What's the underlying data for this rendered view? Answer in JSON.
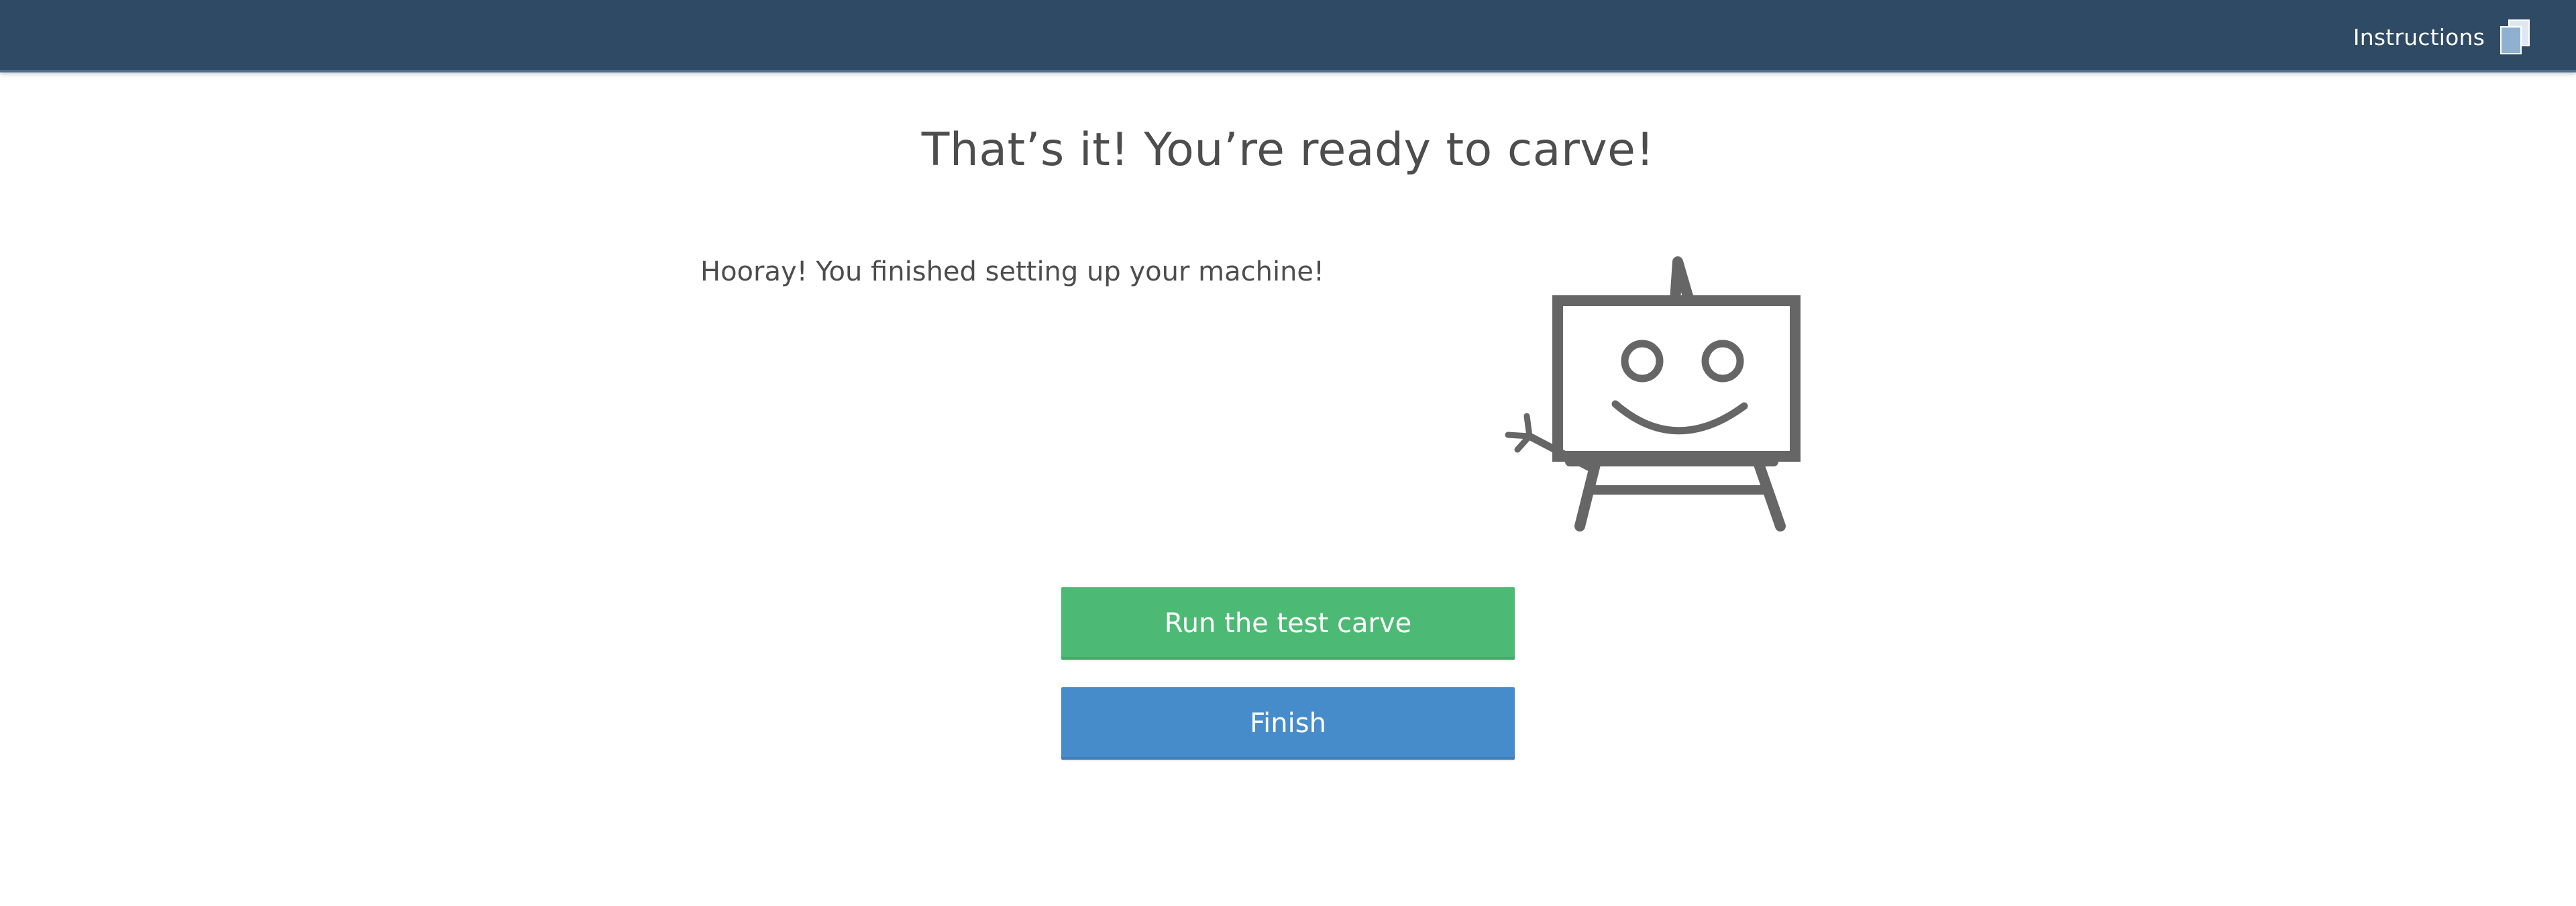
{
  "header": {
    "instructions_label": "Instructions",
    "instructions_icon": "documents-icon",
    "background_color": "#2e4a65"
  },
  "main": {
    "title": "That’s it! You’re ready to carve!",
    "message": "Hooray! You finished setting up your machine!",
    "illustration": "waving-easel-robot-icon"
  },
  "actions": {
    "test_carve_label": "Run the test carve",
    "test_carve_color": "#4cba74",
    "finish_label": "Finish",
    "finish_color": "#478cca"
  }
}
